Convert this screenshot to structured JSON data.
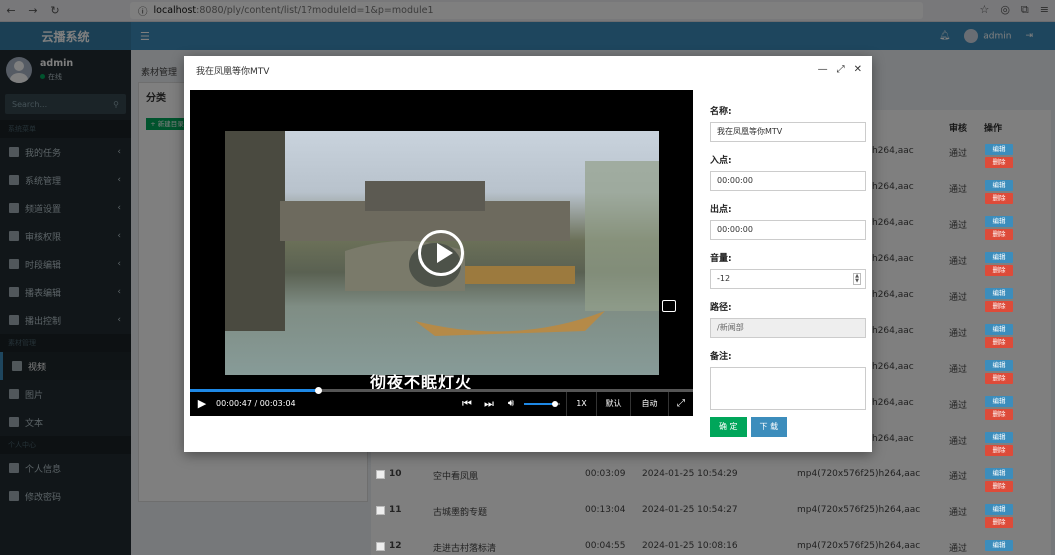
{
  "browser": {
    "host": "localhost",
    "path": ":8080/ply/content/list/1?moduleId=1&p=module1"
  },
  "app": {
    "title": "云播系统",
    "user": "admin",
    "status": "在线",
    "search_placeholder": "Search..."
  },
  "sidebar": {
    "sec1": "系统菜单",
    "items1": [
      "我的任务",
      "系统管理",
      "频道设置",
      "审核权限",
      "时段编辑",
      "播表编辑",
      "播出控制"
    ],
    "sec2": "素材管理",
    "items2": [
      "视频",
      "图片",
      "文本"
    ],
    "sec3": "个人中心",
    "items3": [
      "个人信息",
      "修改密码"
    ]
  },
  "topbar": {
    "user": "admin"
  },
  "content": {
    "breadcrumb": "素材管理",
    "tree_title": "分类",
    "new_dir": "+ 新建目录",
    "col_review": "审核",
    "col_ops": "操作",
    "edit": "编辑",
    "del": "删除",
    "pass": "通过",
    "fmt_tail": "h264,aac"
  },
  "rows": [
    {
      "id": "10",
      "name": "空中看凤凰",
      "dur": "00:03:09",
      "time": "2024-01-25 10:54:29",
      "fmt": "mp4(720x576f25)h264,aac"
    },
    {
      "id": "11",
      "name": "古城墨韵专题",
      "dur": "00:13:04",
      "time": "2024-01-25 10:54:27",
      "fmt": "mp4(720x576f25)h264,aac"
    },
    {
      "id": "12",
      "name": "走进古村落标清",
      "dur": "00:04:55",
      "time": "2024-01-25 10:08:16",
      "fmt": "mp4(720x576f25)h264,aac"
    }
  ],
  "modal": {
    "title": "我在凤凰等你MTV",
    "name_label": "名称:",
    "name": "我在凤凰等你MTV",
    "in_label": "入点:",
    "in": "00:00:00",
    "out_label": "出点:",
    "out": "00:00:00",
    "vol_label": "音量:",
    "vol": "-12",
    "path_label": "路径:",
    "path": "/新闻部",
    "note_label": "备注:",
    "ok": "确 定",
    "download": "下 载"
  },
  "player": {
    "time": "00:00:47 / 00:03:04",
    "progress": 0.255,
    "subtitle": "彻夜不眠灯火",
    "speed": "1X",
    "quality": "默认",
    "mode": "自动",
    "volume": 0.85
  }
}
